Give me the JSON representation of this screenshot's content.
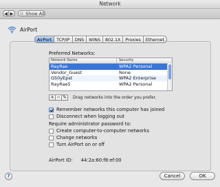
{
  "window": {
    "title": "Network"
  },
  "toolbar": {
    "back": "◀",
    "forward": "▶",
    "show_all": "Show All"
  },
  "section": {
    "title": "AirPort"
  },
  "tabs": [
    {
      "label": "AirPort",
      "active": true
    },
    {
      "label": "TCP/IP"
    },
    {
      "label": "DNS"
    },
    {
      "label": "WINS"
    },
    {
      "label": "802.1X"
    },
    {
      "label": "Proxies"
    },
    {
      "label": "Ethernet"
    }
  ],
  "preferred": {
    "label": "Preferred Networks:",
    "columns": [
      "Network Name",
      "Security"
    ],
    "rows": [
      {
        "name": "RayRae",
        "security": "WPA2 Personal"
      },
      {
        "name": "Vendor_Guest",
        "security": "None"
      },
      {
        "name": "G50yEpst",
        "security": "WPA2 Enterprise"
      },
      {
        "name": "RayRae5",
        "security": "WPA2 Personal"
      }
    ],
    "add": "+",
    "remove": "−",
    "edit": "✎",
    "hint": "Drag networks into the order you prefer."
  },
  "options": {
    "remember": "Remember networks this computer has joined",
    "disconnect": "Disconnect when logging out",
    "require_label": "Require administrator password to:",
    "create": "Create computer-to-computer networks",
    "change": "Change networks",
    "turn": "Turn AirPort on or off"
  },
  "airport_id": {
    "label": "AirPort ID:",
    "value": "44:2a:60:f8:ef:00"
  },
  "buttons": {
    "help": "?",
    "cancel": "Cancel",
    "ok": "OK"
  }
}
